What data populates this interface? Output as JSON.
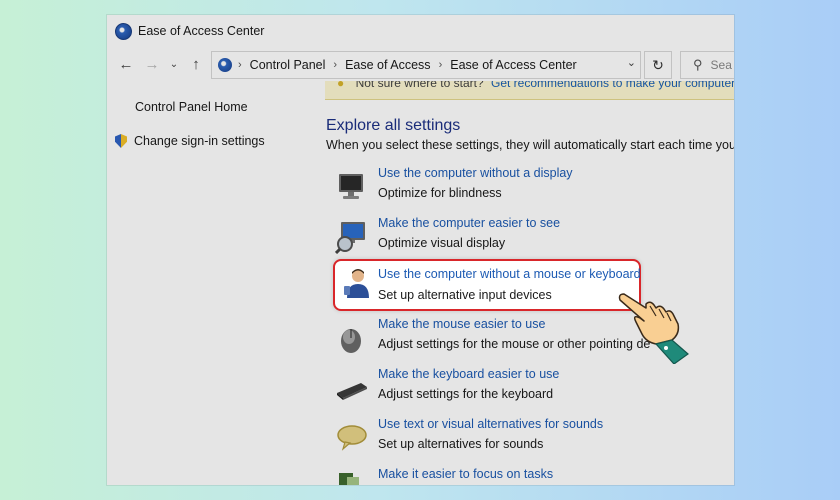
{
  "window": {
    "title": "Ease of Access Center"
  },
  "navbar": {
    "breadcrumbs": [
      "Control Panel",
      "Ease of Access",
      "Ease of Access Center"
    ],
    "search_placeholder": "Sea"
  },
  "sidebar": {
    "home": "Control Panel Home",
    "signin": "Change sign-in settings"
  },
  "banner": {
    "prefix": "Not sure where to start?",
    "link": "Get recommendations to make your computer e"
  },
  "main": {
    "title": "Explore all settings",
    "description": "When you select these settings, they will automatically start each time you sign",
    "items": [
      {
        "link": "Use the computer without a display",
        "desc": "Optimize for blindness",
        "icon": "monitor-icon"
      },
      {
        "link": "Make the computer easier to see",
        "desc": "Optimize visual display",
        "icon": "magnifier-monitor-icon"
      },
      {
        "link": "Use the computer without a mouse or keyboard",
        "desc": "Set up alternative input devices",
        "icon": "user-icon"
      },
      {
        "link": "Make the mouse easier to use",
        "desc": "Adjust settings for the mouse or other pointing de",
        "icon": "mouse-icon"
      },
      {
        "link": "Make the keyboard easier to use",
        "desc": "Adjust settings for the keyboard",
        "icon": "keyboard-icon"
      },
      {
        "link": "Use text or visual alternatives for sounds",
        "desc": "Set up alternatives for sounds",
        "icon": "speech-bubble-icon"
      },
      {
        "link": "Make it easier to focus on tasks",
        "desc": "",
        "icon": "focus-icon"
      }
    ]
  },
  "colors": {
    "link": "#1c5ab3",
    "heading": "#1e3287",
    "highlight_border": "#d9262a"
  }
}
